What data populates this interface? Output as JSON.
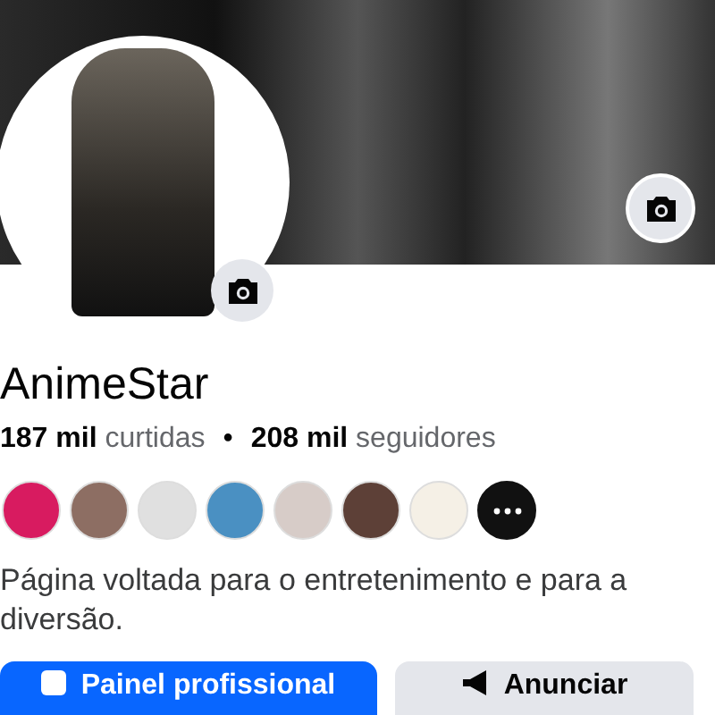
{
  "page": {
    "name": "AnimeStar",
    "likes_count": "187 mil",
    "likes_label": "curtidas",
    "separator": "•",
    "followers_count": "208 mil",
    "followers_label": "seguidores",
    "description": "Página voltada para o entretenimento e para a diversão."
  },
  "follower_avatars": [
    {
      "kind": "photo"
    },
    {
      "kind": "photo"
    },
    {
      "kind": "photo"
    },
    {
      "kind": "photo"
    },
    {
      "kind": "photo"
    },
    {
      "kind": "photo"
    },
    {
      "kind": "photo"
    },
    {
      "kind": "more"
    }
  ],
  "buttons": [
    {
      "label": "Painel profissional",
      "kind": "primary"
    },
    {
      "label": "Anunciar",
      "kind": "secondary"
    }
  ]
}
